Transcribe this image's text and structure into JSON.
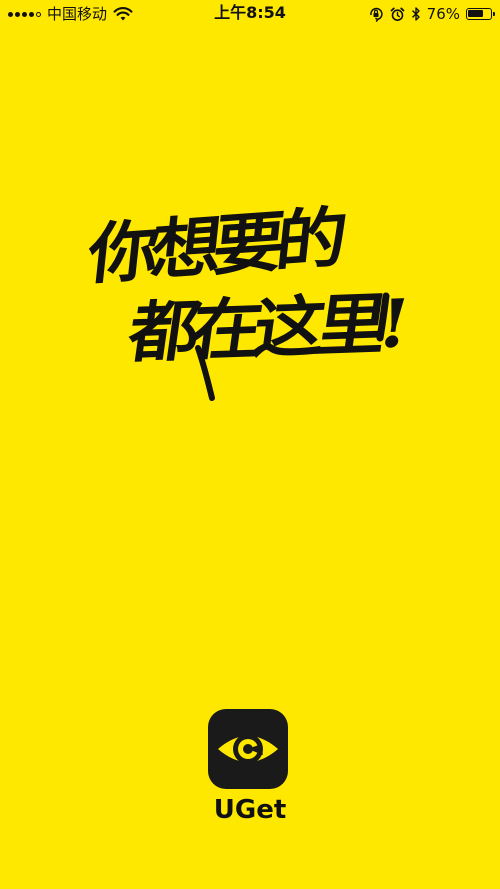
{
  "status_bar": {
    "carrier": "中国移动",
    "time": "上午8:54",
    "battery_percent": "76%",
    "battery_level": 0.76,
    "icons": [
      "signal-icon",
      "wifi-icon",
      "orientation-lock-icon",
      "alarm-icon",
      "bluetooth-icon",
      "battery-icon"
    ]
  },
  "splash": {
    "slogan_line1": "你想要的",
    "slogan_line2": "都在这里!",
    "app_name": "UGet"
  },
  "colors": {
    "background": "#FFE800",
    "text": "#111111",
    "logo_background": "#1A1A1A",
    "logo_accent": "#FFE800"
  }
}
